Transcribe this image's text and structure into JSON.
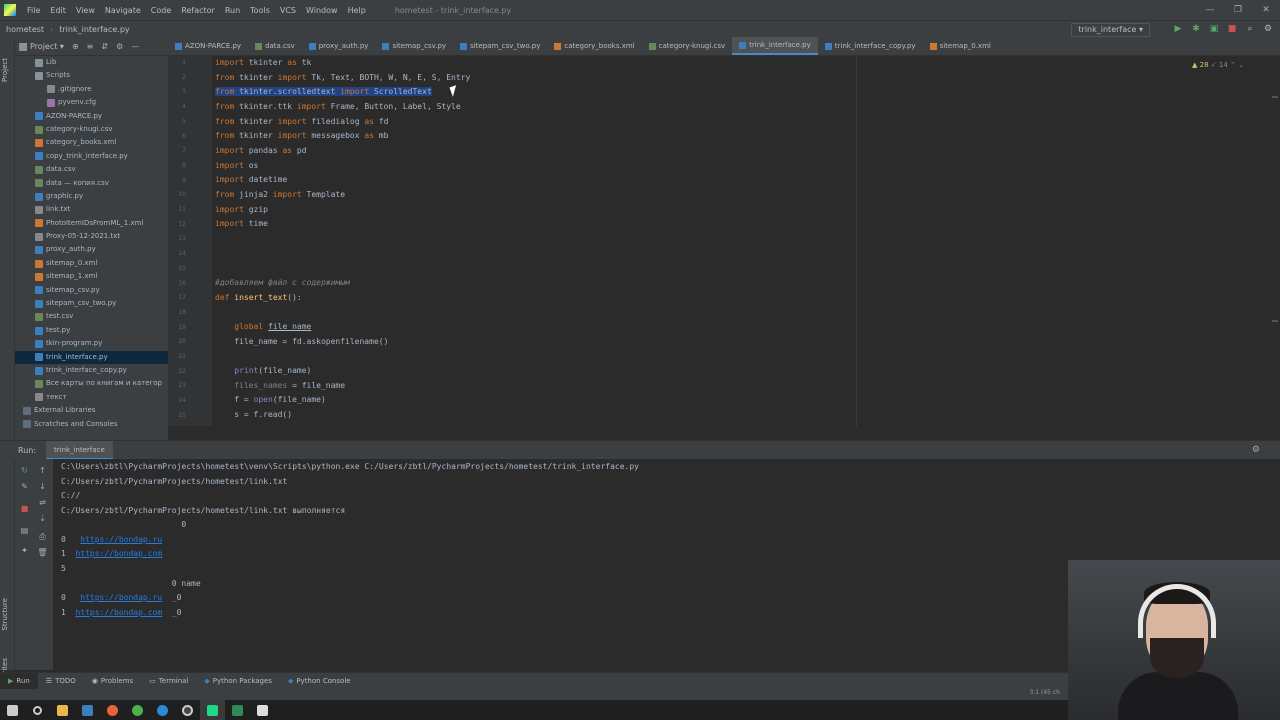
{
  "menubar": {
    "items": [
      "File",
      "Edit",
      "View",
      "Navigate",
      "Code",
      "Refactor",
      "Run",
      "Tools",
      "VCS",
      "Window",
      "Help"
    ],
    "window_title": "hometest - trink_interface.py"
  },
  "navbar": {
    "project": "hometest",
    "file": "trink_interface.py",
    "run_config": "trink_interface ▾"
  },
  "project_panel": {
    "title": "Project ▾",
    "items": [
      {
        "label": "Lib",
        "type": "folder"
      },
      {
        "label": "Scripts",
        "type": "folder"
      },
      {
        "label": ".gitignore",
        "type": "txt"
      },
      {
        "label": "pyvenv.cfg",
        "type": "cfg"
      },
      {
        "label": "AZON-PARCE.py",
        "type": "py"
      },
      {
        "label": "category-knugi.csv",
        "type": "csv"
      },
      {
        "label": "category_books.xml",
        "type": "xml"
      },
      {
        "label": "copy_trink_interface.py",
        "type": "py"
      },
      {
        "label": "data.csv",
        "type": "csv"
      },
      {
        "label": "data — копия.csv",
        "type": "csv"
      },
      {
        "label": "graphic.py",
        "type": "py"
      },
      {
        "label": "link.txt",
        "type": "txt"
      },
      {
        "label": "PhotoItemIDsFromML_1.xml",
        "type": "xml"
      },
      {
        "label": "Proxy-05-12-2021.txt",
        "type": "txt"
      },
      {
        "label": "proxy_auth.py",
        "type": "py"
      },
      {
        "label": "sitemap_0.xml",
        "type": "xml"
      },
      {
        "label": "sitemap_1.xml",
        "type": "xml"
      },
      {
        "label": "sitemap_csv.py",
        "type": "py"
      },
      {
        "label": "sitepam_csv_two.py",
        "type": "py"
      },
      {
        "label": "test.csv",
        "type": "csv"
      },
      {
        "label": "test.py",
        "type": "py"
      },
      {
        "label": "tkin-program.py",
        "type": "py"
      },
      {
        "label": "trink_interface.py",
        "type": "py",
        "selected": true
      },
      {
        "label": "trink_interface_copy.py",
        "type": "py"
      },
      {
        "label": "Все карты по книгам и категор",
        "type": "csv"
      },
      {
        "label": "текст",
        "type": "txt"
      },
      {
        "label": "External Libraries",
        "type": "ext"
      },
      {
        "label": "Scratches and Consoles",
        "type": "ext"
      }
    ]
  },
  "tabs": [
    {
      "label": "AZON-PARCE.py"
    },
    {
      "label": "data.csv"
    },
    {
      "label": "proxy_auth.py"
    },
    {
      "label": "sitemap_csv.py"
    },
    {
      "label": "sitepam_csv_two.py"
    },
    {
      "label": "category_books.xml"
    },
    {
      "label": "category-knugi.csv"
    },
    {
      "label": "trink_interface.py",
      "active": true
    },
    {
      "label": "trink_interface_copy.py"
    },
    {
      "label": "sitemap_0.xml"
    }
  ],
  "editor": {
    "line_numbers": [
      "1",
      "2",
      "3",
      "4",
      "5",
      "6",
      "7",
      "8",
      "9",
      "10",
      "11",
      "12",
      "13",
      "14",
      "15",
      "16",
      "17",
      "18",
      "19",
      "20",
      "21",
      "22",
      "23",
      "24",
      "25"
    ],
    "inspections_warn": "▲ 28",
    "inspections_weak": "✓ 14"
  },
  "run_panel": {
    "label": "Run:",
    "tab": "trink_interface",
    "console": [
      "C:\\Users\\zbtl\\PycharmProjects\\hometest\\venv\\Scripts\\python.exe C:/Users/zbtl/PycharmProjects/hometest/trink_interface.py",
      "C:/Users/zbtl/PycharmProjects/hometest/link.txt",
      "C://",
      "C:/Users/zbtl/PycharmProjects/hometest/link.txt выполняется",
      "                         0",
      "0  ",
      "1 ",
      "5",
      "                       0 name",
      "0  ",
      "1 "
    ],
    "links": [
      "https://bondap.ru",
      "https://bondap.com",
      "https://bondap.ru",
      "https://bondap.com"
    ],
    "suffix": "_0"
  },
  "bottom_tabs": [
    "Run",
    "TODO",
    "Problems",
    "Terminal",
    "Python Packages",
    "Python Console"
  ],
  "status": {
    "position": "3:1 (45 ch"
  }
}
